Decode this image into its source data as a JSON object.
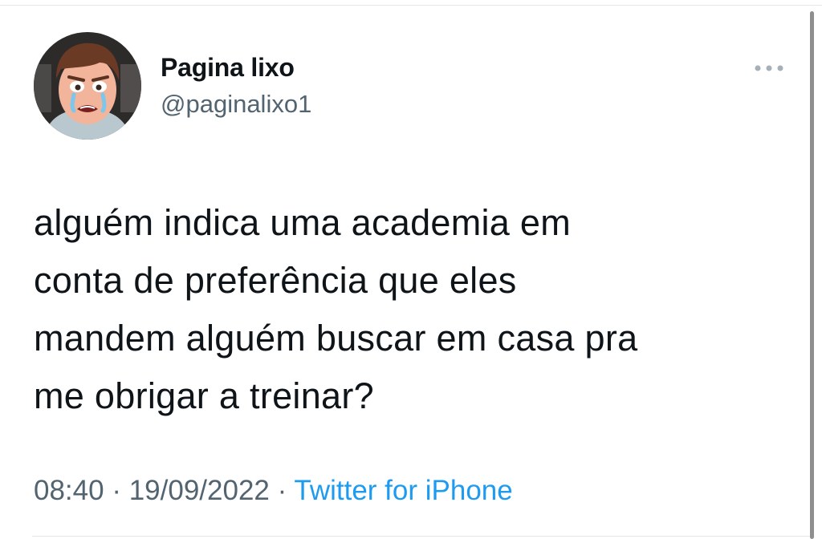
{
  "tweet": {
    "author": {
      "display_name": "Pagina lixo",
      "handle": "@paginalixo1",
      "avatar_icon": "cartoon-man-crying-avatar"
    },
    "more_icon": "more-options-icon",
    "text_lines": [
      "alguém indica uma academia em",
      "conta de preferência que eles",
      "mandem alguém buscar em casa pra",
      "me obrigar a treinar?"
    ],
    "meta": {
      "time": "08:40",
      "separator": "·",
      "date": "19/09/2022",
      "source": "Twitter for iPhone"
    }
  },
  "colors": {
    "text": "#0f1419",
    "secondary": "#536471",
    "accent": "#1d9bf0"
  }
}
